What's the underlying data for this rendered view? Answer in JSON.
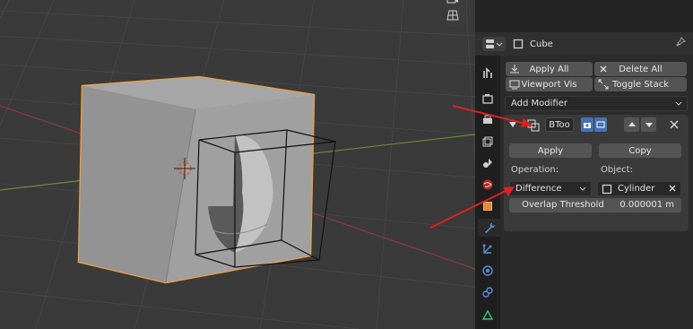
{
  "viewport": {
    "buttons": [
      {
        "icon": "camera-view-icon"
      },
      {
        "icon": "grid-view-icon"
      }
    ]
  },
  "header": {
    "object_name": "Cube",
    "editor_icon": "properties-editor-icon",
    "pin_icon": "pin-icon"
  },
  "tabs": [
    {
      "icon": "tool-icon"
    },
    {
      "icon": "render-icon"
    },
    {
      "icon": "output-icon"
    },
    {
      "icon": "view-layer-icon"
    },
    {
      "icon": "scene-icon"
    },
    {
      "icon": "world-icon"
    },
    {
      "icon": "object-icon"
    },
    {
      "icon": "modifier-wrench-icon"
    },
    {
      "icon": "particles-icon"
    },
    {
      "icon": "physics-icon"
    },
    {
      "icon": "constraints-icon"
    },
    {
      "icon": "data-icon"
    }
  ],
  "toolbar": {
    "apply_all": "Apply All",
    "delete_all": "Delete All",
    "viewport_vis": "Viewport Vis",
    "toggle_stack": "Toggle Stack"
  },
  "add_modifier": "Add Modifier",
  "modifier": {
    "name": "BToo",
    "apply": "Apply",
    "copy": "Copy",
    "operation_label": "Operation:",
    "operation_value": "Difference",
    "object_label": "Object:",
    "object_value": "Cylinder",
    "overlap_label": "Overlap Threshold",
    "overlap_value": "0.000001 m"
  },
  "colors": {
    "accent_blue": "#4772b3",
    "selection_orange": "#f0a040",
    "annotation_red": "#e02020",
    "wrench_blue": "#5a8fd8"
  }
}
